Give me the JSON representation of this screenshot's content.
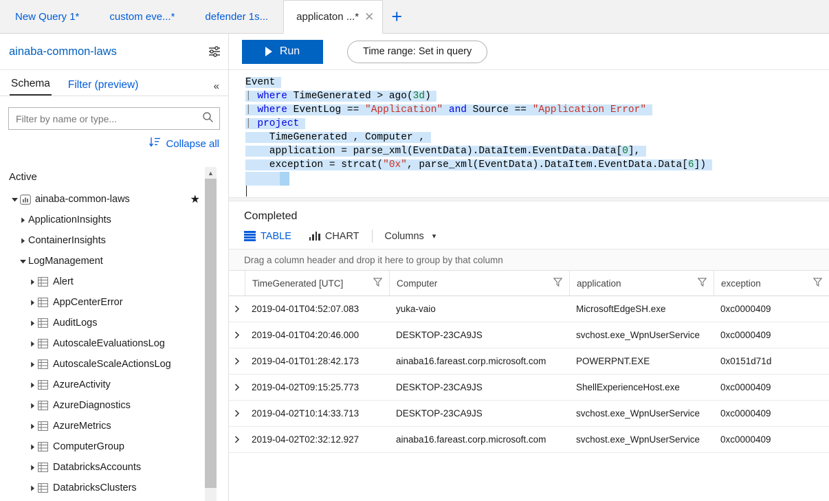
{
  "tabs": [
    {
      "label": "New Query 1*",
      "active": false
    },
    {
      "label": "custom eve...*",
      "active": false
    },
    {
      "label": "defender 1s...",
      "active": false
    },
    {
      "label": "applicaton ...*",
      "active": true
    }
  ],
  "new_tab_label": "+",
  "tab_close_label": "✕",
  "workspace": {
    "name": "ainaba-common-laws",
    "settings_icon": "sliders-icon"
  },
  "sidebar": {
    "tabs": [
      {
        "label": "Schema",
        "active": true
      },
      {
        "label": "Filter (preview)",
        "active": false
      }
    ],
    "collapse_chevron": "«",
    "filter_placeholder": "Filter by name or type...",
    "filter_value": "",
    "search_icon": "search-icon",
    "collapse_all_label": "Collapse all",
    "sort_icon": "sort-descending-icon",
    "section_label": "Active",
    "tree": [
      {
        "label": "ainaba-common-laws",
        "level": 1,
        "expanded": true,
        "icon": "workspace-icon",
        "starred": true
      },
      {
        "label": "ApplicationInsights",
        "level": 2,
        "expanded": false,
        "icon": "none"
      },
      {
        "label": "ContainerInsights",
        "level": 2,
        "expanded": false,
        "icon": "none"
      },
      {
        "label": "LogManagement",
        "level": 2,
        "expanded": true,
        "icon": "none"
      },
      {
        "label": "Alert",
        "level": 3,
        "expanded": false,
        "icon": "table-icon"
      },
      {
        "label": "AppCenterError",
        "level": 3,
        "expanded": false,
        "icon": "table-icon"
      },
      {
        "label": "AuditLogs",
        "level": 3,
        "expanded": false,
        "icon": "table-icon"
      },
      {
        "label": "AutoscaleEvaluationsLog",
        "level": 3,
        "expanded": false,
        "icon": "table-icon"
      },
      {
        "label": "AutoscaleScaleActionsLog",
        "level": 3,
        "expanded": false,
        "icon": "table-icon"
      },
      {
        "label": "AzureActivity",
        "level": 3,
        "expanded": false,
        "icon": "table-icon"
      },
      {
        "label": "AzureDiagnostics",
        "level": 3,
        "expanded": false,
        "icon": "table-icon"
      },
      {
        "label": "AzureMetrics",
        "level": 3,
        "expanded": false,
        "icon": "table-icon"
      },
      {
        "label": "ComputerGroup",
        "level": 3,
        "expanded": false,
        "icon": "table-icon"
      },
      {
        "label": "DatabricksAccounts",
        "level": 3,
        "expanded": false,
        "icon": "table-icon"
      },
      {
        "label": "DatabricksClusters",
        "level": 3,
        "expanded": false,
        "icon": "table-icon"
      }
    ]
  },
  "toolbar": {
    "run_label": "Run",
    "run_icon": "play-icon",
    "run_color": "#0063c1",
    "time_range_label": "Time range: Set in query"
  },
  "query": {
    "lines": [
      "Event",
      "| where TimeGenerated > ago(3d)",
      "| where EventLog == \"Application\" and Source == \"Application Error\"",
      "| project",
      "    TimeGenerated , Computer ,",
      "    application = parse_xml(EventData).DataItem.EventData.Data[0],",
      "    exception = strcat(\"0x\", parse_xml(EventData).DataItem.EventData.Data[6])"
    ],
    "selection_color": "#cfe6fa",
    "keyword_color": "#0000e0",
    "string_color": "#c72f25",
    "number_color": "#0a7d33"
  },
  "results": {
    "status": "Completed",
    "views": [
      {
        "label": "TABLE",
        "icon": "grid-icon",
        "active": true
      },
      {
        "label": "CHART",
        "icon": "bar-chart-icon",
        "active": false
      }
    ],
    "columns_menu_label": "Columns",
    "columns_menu_chevron": "⌄",
    "group_hint": "Drag a column header and drop it here to group by that column",
    "headers": [
      "TimeGenerated [UTC]",
      "Computer",
      "application",
      "exception"
    ],
    "filter_icon": "funnel-icon",
    "row_expander_icon": "chevron-right-icon",
    "rows": [
      {
        "time": "2019-04-01T04:52:07.083",
        "computer": "yuka-vaio",
        "application": "MicrosoftEdgeSH.exe",
        "exception": "0xc0000409"
      },
      {
        "time": "2019-04-01T04:20:46.000",
        "computer": "DESKTOP-23CA9JS",
        "application": "svchost.exe_WpnUserService",
        "exception": "0xc0000409"
      },
      {
        "time": "2019-04-01T01:28:42.173",
        "computer": "ainaba16.fareast.corp.microsoft.com",
        "application": "POWERPNT.EXE",
        "exception": "0x0151d71d"
      },
      {
        "time": "2019-04-02T09:15:25.773",
        "computer": "DESKTOP-23CA9JS",
        "application": "ShellExperienceHost.exe",
        "exception": "0xc0000409"
      },
      {
        "time": "2019-04-02T10:14:33.713",
        "computer": "DESKTOP-23CA9JS",
        "application": "svchost.exe_WpnUserService",
        "exception": "0xc0000409"
      },
      {
        "time": "2019-04-02T02:32:12.927",
        "computer": "ainaba16.fareast.corp.microsoft.com",
        "application": "svchost.exe_WpnUserService",
        "exception": "0xc0000409"
      }
    ]
  }
}
